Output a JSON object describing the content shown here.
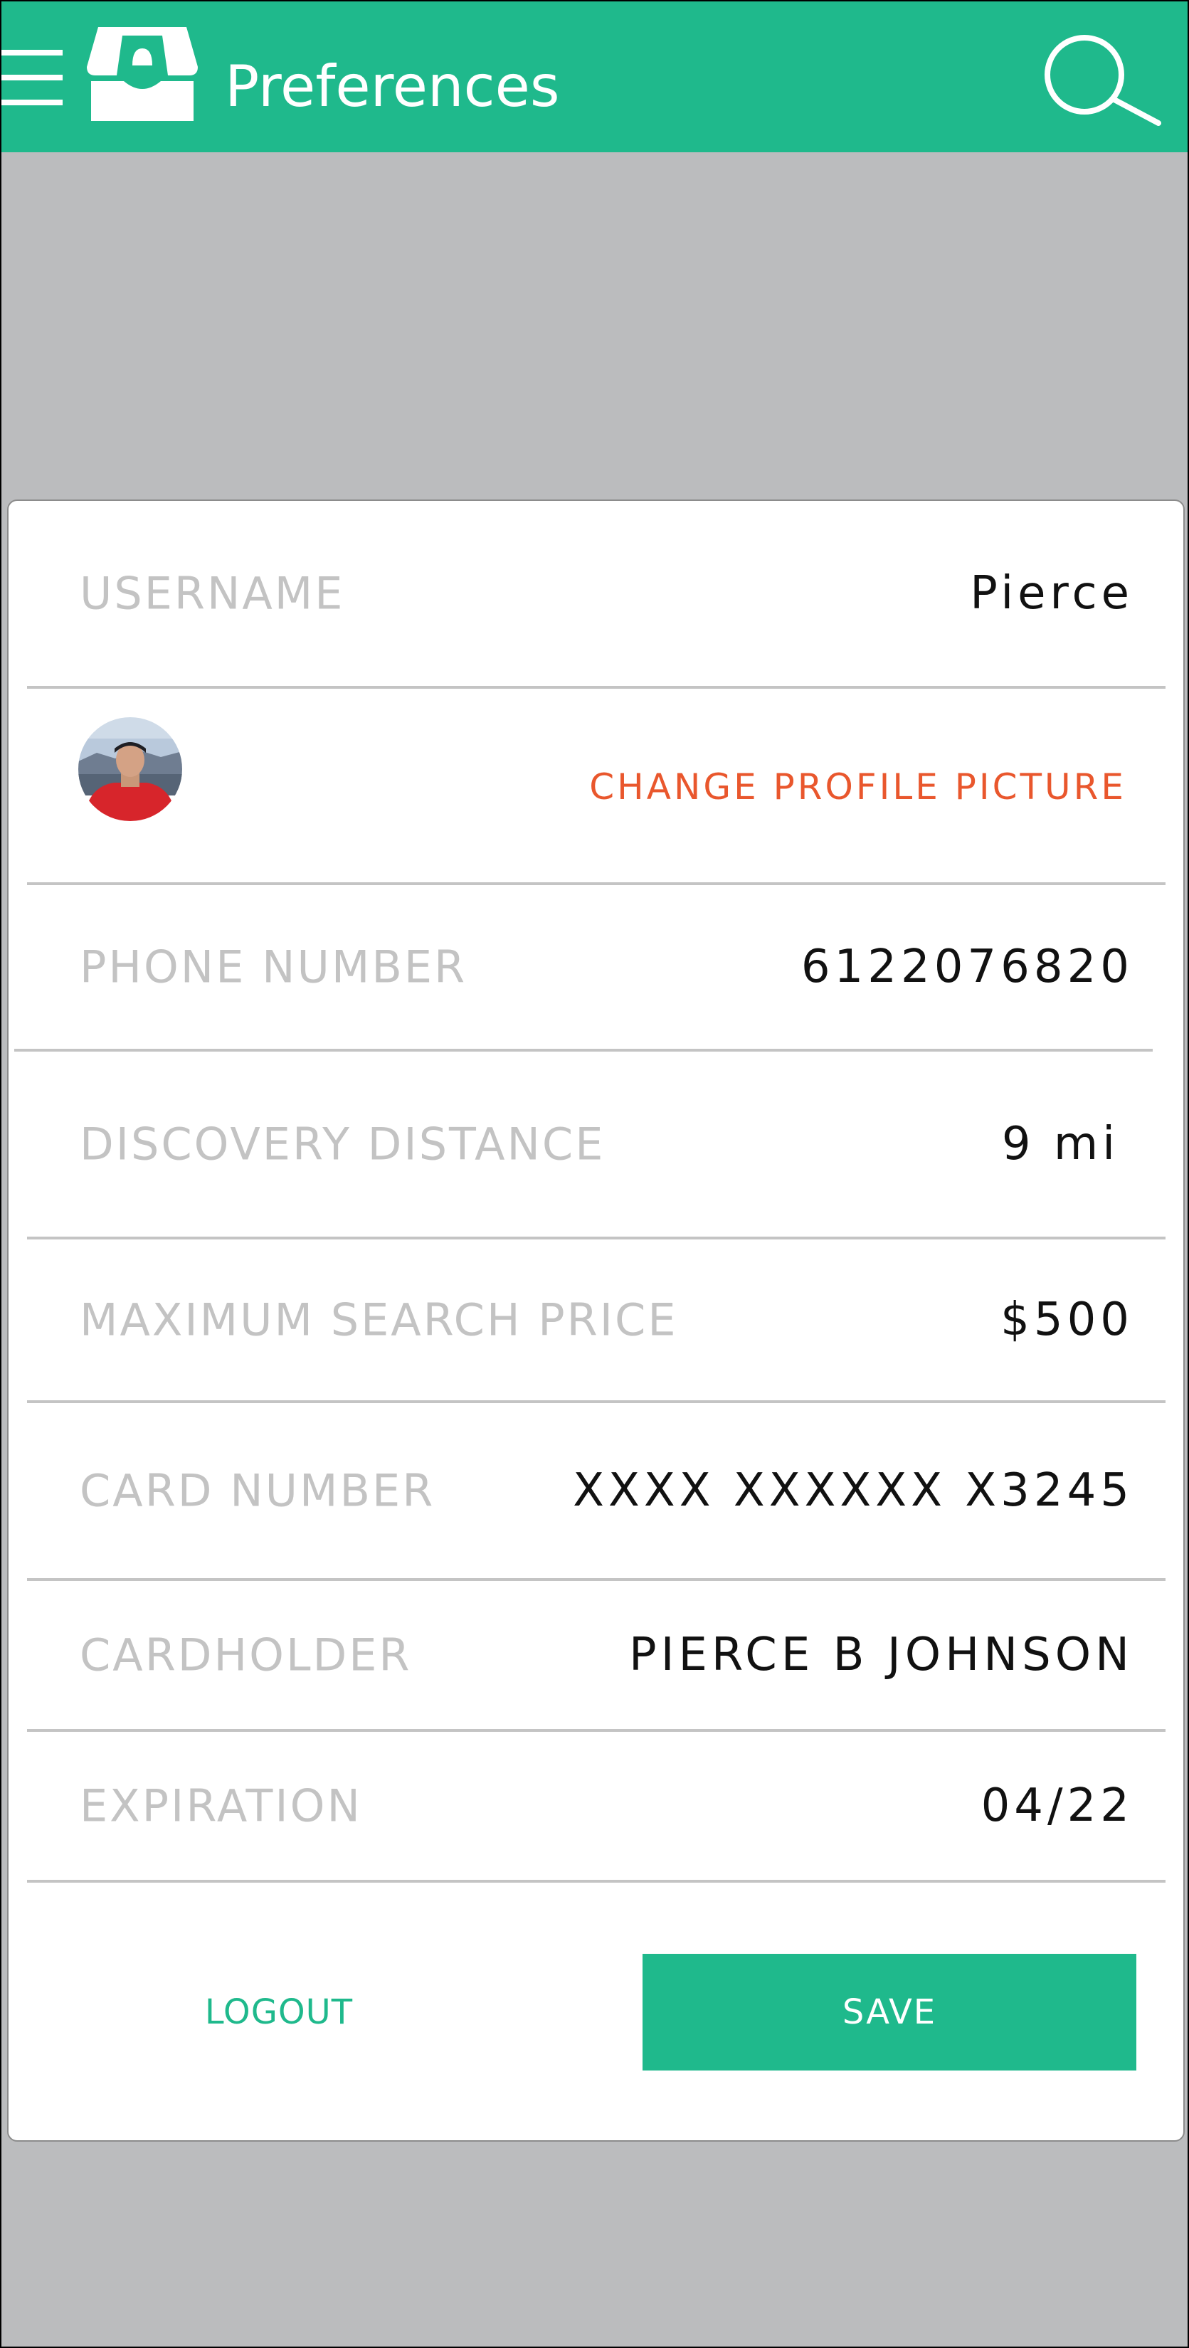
{
  "appbar": {
    "title": "Preferences",
    "color": "#1fb98c",
    "icons": [
      "hamburger-menu-icon",
      "storefront-logo-icon",
      "search-icon"
    ]
  },
  "preferences": {
    "username": {
      "label": "USERNAME",
      "value": "Pierce"
    },
    "profile_picture": {
      "action_label": "CHANGE PROFILE PICTURE",
      "action_color": "#e9572d"
    },
    "phone": {
      "label": "PHONE NUMBER",
      "value": "6122076820"
    },
    "distance": {
      "label": "DISCOVERY DISTANCE",
      "value": "9 mi"
    },
    "max_price": {
      "label": "MAXIMUM SEARCH PRICE",
      "value": "$500"
    },
    "card_number": {
      "label": "CARD NUMBER",
      "value": "XXXX XXXXXX X3245"
    },
    "cardholder": {
      "label": "CARDHOLDER",
      "value": "PIERCE B JOHNSON"
    },
    "expiration": {
      "label": "EXPIRATION",
      "value": "04/22"
    }
  },
  "actions": {
    "logout_label": "LOGOUT",
    "save_label": "SAVE"
  }
}
